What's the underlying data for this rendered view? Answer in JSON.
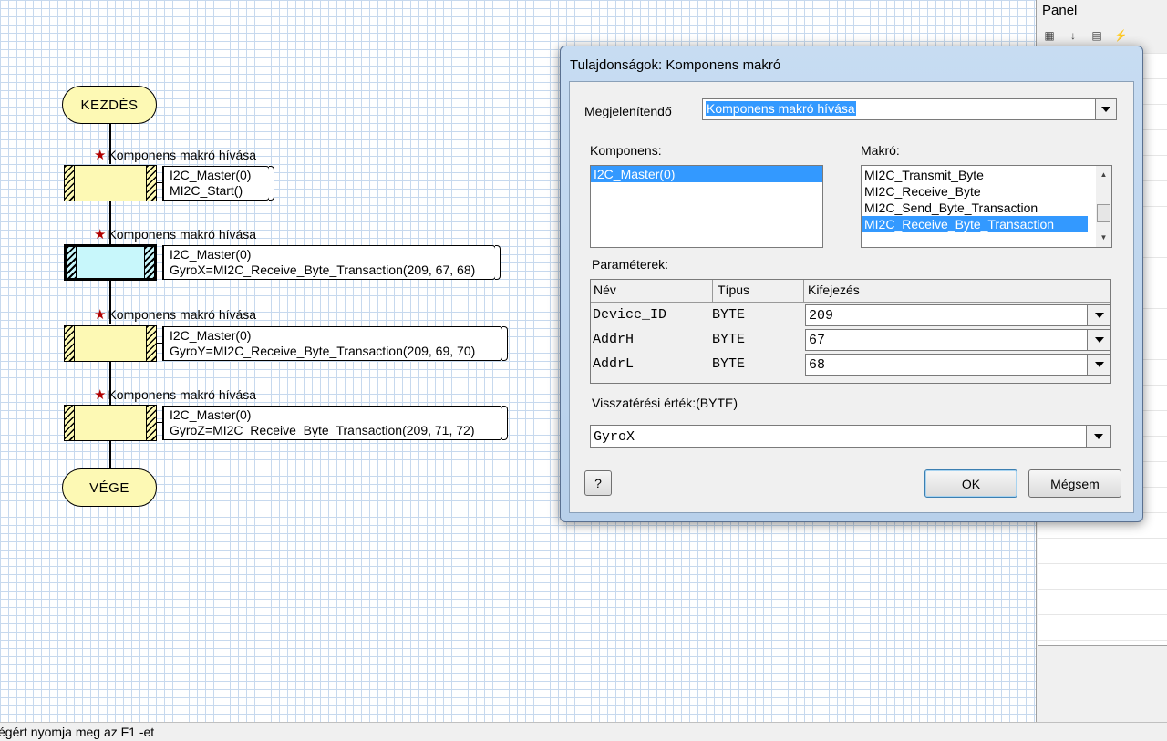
{
  "flowchart": {
    "start_label": "KEZDÉS",
    "end_label": "VÉGE",
    "macros": [
      {
        "label": "Komponens makró hívása",
        "line1": "I2C_Master(0)",
        "line2": "MI2C_Start()"
      },
      {
        "label": "Komponens makró hívása",
        "line1": "I2C_Master(0)",
        "line2": "GyroX=MI2C_Receive_Byte_Transaction(209, 67, 68)"
      },
      {
        "label": "Komponens makró hívása",
        "line1": "I2C_Master(0)",
        "line2": "GyroY=MI2C_Receive_Byte_Transaction(209, 69, 70)"
      },
      {
        "label": "Komponens makró hívása",
        "line1": "I2C_Master(0)",
        "line2": "GyroZ=MI2C_Receive_Byte_Transaction(209, 71, 72)"
      }
    ]
  },
  "right_panel": {
    "title": "Panel"
  },
  "status_bar": {
    "text": "égért nyomja meg az F1 -et"
  },
  "dialog": {
    "title": "Tulajdonságok: Komponens makró",
    "display_label": "Megjelenítendő",
    "display_value": "Komponens makró hívása",
    "component_label": "Komponens:",
    "components": [
      "I2C_Master(0)"
    ],
    "macro_label": "Makró:",
    "macros": [
      "MI2C_Transmit_Byte",
      "MI2C_Receive_Byte",
      "MI2C_Send_Byte_Transaction",
      "MI2C_Receive_Byte_Transaction"
    ],
    "params_label": "Paraméterek:",
    "params_headers": {
      "name": "Név",
      "type": "Típus",
      "expr": "Kifejezés"
    },
    "params": [
      {
        "name": "Device_ID",
        "type": "BYTE",
        "value": "209"
      },
      {
        "name": "AddrH",
        "type": "BYTE",
        "value": "67"
      },
      {
        "name": "AddrL",
        "type": "BYTE",
        "value": "68"
      }
    ],
    "return_label": "Visszatérési érték:(BYTE)",
    "return_value": "GyroX",
    "help_label": "?",
    "ok_label": "OK",
    "cancel_label": "Mégsem"
  }
}
